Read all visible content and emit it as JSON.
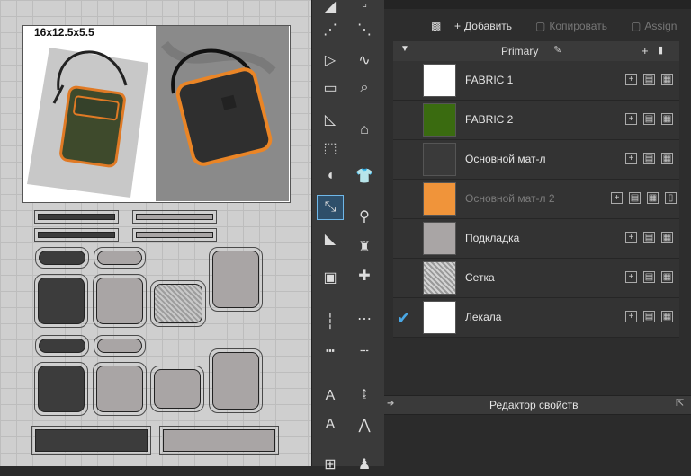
{
  "canvas": {
    "photo_caption": "16x12.5x5.5"
  },
  "toolbar": {
    "add_label": "Добавить",
    "copy_label": "Копировать",
    "assign_label": "Assign"
  },
  "materials": {
    "group_name": "Primary",
    "items": [
      {
        "name": "FABRIC 1",
        "color": "#ffffff",
        "dimmed": false,
        "checked": false
      },
      {
        "name": "FABRIC 2",
        "color": "#3a6b10",
        "dimmed": false,
        "checked": false
      },
      {
        "name": "Основной мат-л",
        "color": "#3a3a3a",
        "dimmed": false,
        "checked": false
      },
      {
        "name": "Основной мат-л 2",
        "color": "#f0943a",
        "dimmed": true,
        "checked": false
      },
      {
        "name": "Подкладка",
        "color": "#a9a5a5",
        "dimmed": false,
        "checked": false
      },
      {
        "name": "Сетка",
        "color": "mesh-pattern",
        "dimmed": false,
        "checked": false
      },
      {
        "name": "Лекала",
        "color": "#ffffff",
        "dimmed": false,
        "checked": true
      }
    ]
  },
  "property_editor": {
    "title": "Редактор свойств"
  },
  "colors": {
    "accent": "#4aa8e6",
    "panel_bg": "#2d2d2d",
    "canvas_bg": "#cfcfcf"
  }
}
